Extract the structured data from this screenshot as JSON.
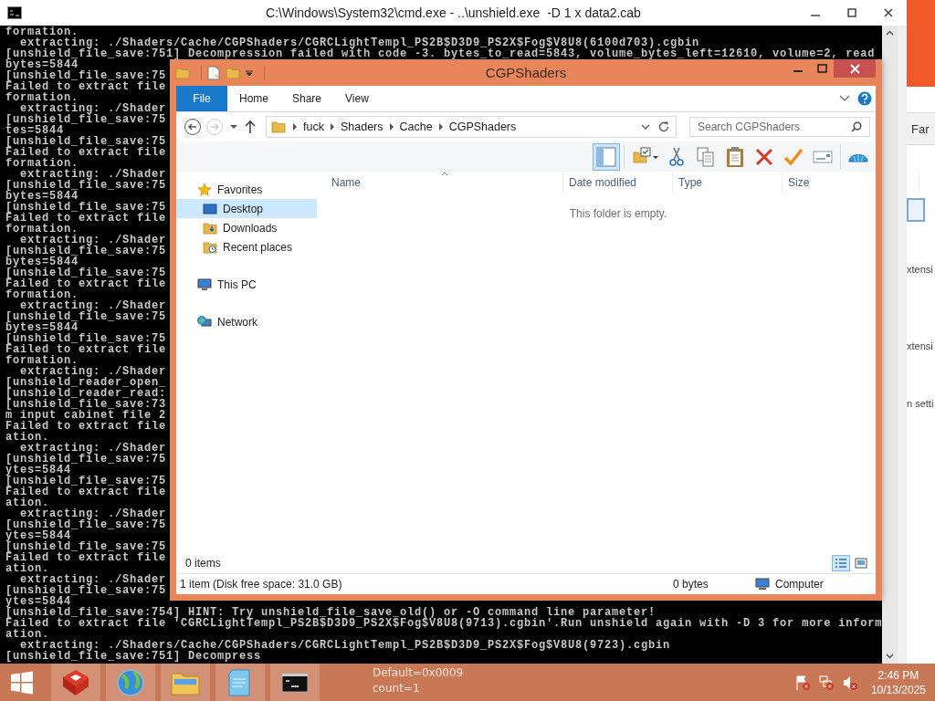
{
  "background_window": {
    "tab": "Far",
    "lines": [
      "xtensi",
      "xtensi",
      "n setti"
    ]
  },
  "cmd_window": {
    "title": "C:\\Windows\\System32\\cmd.exe - ..\\unshield.exe  -D 1 x data2.cab",
    "lines": [
      "formation.",
      "  extracting: ./Shaders/Cache/CGPShaders/CGRCLightTempl_PS2B$D3D9_PS2X$Fog$V8U8(6100d703).cgbin",
      "[unshield_file_save:751] Decompression failed with code -3. bytes_to_read=5843, volume_bytes_left=12610, volume=2, read",
      "bytes=5844",
      "[unshield_file_save:75",
      "Failed to extract file",
      "formation.",
      "  extracting: ./Shader",
      "[unshield_file_save:75",
      "tes=5844",
      "[unshield_file_save:75",
      "Failed to extract file",
      "formation.",
      "  extracting: ./Shader",
      "[unshield_file_save:75",
      "bytes=5844",
      "[unshield_file_save:75",
      "Failed to extract file",
      "formation.",
      "  extracting: ./Shader",
      "[unshield_file_save:75",
      "bytes=5844",
      "[unshield_file_save:75",
      "Failed to extract file",
      "formation.",
      "  extracting: ./Shader",
      "[unshield_file_save:75",
      "bytes=5844",
      "[unshield_file_save:75",
      "Failed to extract file",
      "formation.",
      "  extracting: ./Shader",
      "[unshield_reader_open_",
      "[unshield_reader_read:",
      "[unshield_file_save:73",
      "m input cabinet file 2",
      "Failed to extract file",
      "ation.",
      "  extracting: ./Shader",
      "[unshield_file_save:75",
      "ytes=5844",
      "[unshield_file_save:75",
      "Failed to extract file",
      "ation.",
      "  extracting: ./Shader",
      "[unshield_file_save:75",
      "ytes=5844",
      "[unshield_file_save:75",
      "Failed to extract file",
      "ation.",
      "  extracting: ./Shader",
      "[unshield_file_save:75",
      "ytes=5844",
      "[unshield_file_save:754] HINT: Try unshield_file_save_old() or -O command line parameter!",
      "Failed to extract file 'CGRCLightTempl_PS2B$D3D9_PS2X$Fog$V8U8(9713).cgbin'.Run unshield again with -D 3 for more inform",
      "ation.",
      "  extracting: ./Shaders/Cache/CGPShaders/CGRCLightTempl_PS2B$D3D9_PS2X$Fog$V8U8(9723).cgbin",
      "[unshield_file_save:751] Decompress"
    ]
  },
  "explorer": {
    "title": "CGPShaders",
    "file_tab": "File",
    "tabs": [
      "Home",
      "Share",
      "View"
    ],
    "breadcrumb": [
      "fuck",
      "Shaders",
      "Cache",
      "CGPShaders"
    ],
    "search": {
      "placeholder": "Search CGPShaders"
    },
    "toolbar": [
      {
        "kind": "preview-pane",
        "selected": true
      },
      {
        "kind": "folder-options",
        "selected": false
      },
      {
        "kind": "cut",
        "selected": false
      },
      {
        "kind": "copy",
        "selected": false
      },
      {
        "kind": "paste",
        "selected": false
      },
      {
        "kind": "delete",
        "selected": false
      },
      {
        "kind": "approve",
        "selected": false
      },
      {
        "kind": "rename",
        "selected": false
      },
      {
        "kind": "shell",
        "selected": false
      }
    ],
    "nav": [
      {
        "label": "Favorites",
        "kind": "favorites",
        "selected": false,
        "children": [
          {
            "label": "Desktop",
            "kind": "desktop",
            "selected": true
          },
          {
            "label": "Downloads",
            "kind": "downloads",
            "selected": false
          },
          {
            "label": "Recent places",
            "kind": "recent",
            "selected": false
          }
        ]
      },
      {
        "label": "This PC",
        "kind": "pc",
        "selected": false
      },
      {
        "label": "Network",
        "kind": "network",
        "selected": false
      }
    ],
    "columns": [
      "Name",
      "Date modified",
      "Type",
      "Size"
    ],
    "empty_message": "This folder is empty.",
    "item_count": "0 items",
    "view_buttons": [
      {
        "kind": "details",
        "selected": true
      },
      {
        "kind": "large-icons",
        "selected": false
      }
    ],
    "status_bar": {
      "items": "1 item (Disk free space: 31.0 GB)",
      "size": "0 bytes",
      "location": "Computer"
    }
  },
  "taskbar": {
    "apps": [
      {
        "kind": "toolbox",
        "running": true
      },
      {
        "kind": "globe",
        "running": true
      },
      {
        "kind": "folder",
        "running": true
      },
      {
        "kind": "notepad",
        "running": true
      },
      {
        "kind": "console",
        "running": true
      }
    ],
    "overlay_lines": [
      "Default=0x0009",
      "count=1"
    ],
    "time": "2:46 PM",
    "date": "10/13/2025"
  }
}
